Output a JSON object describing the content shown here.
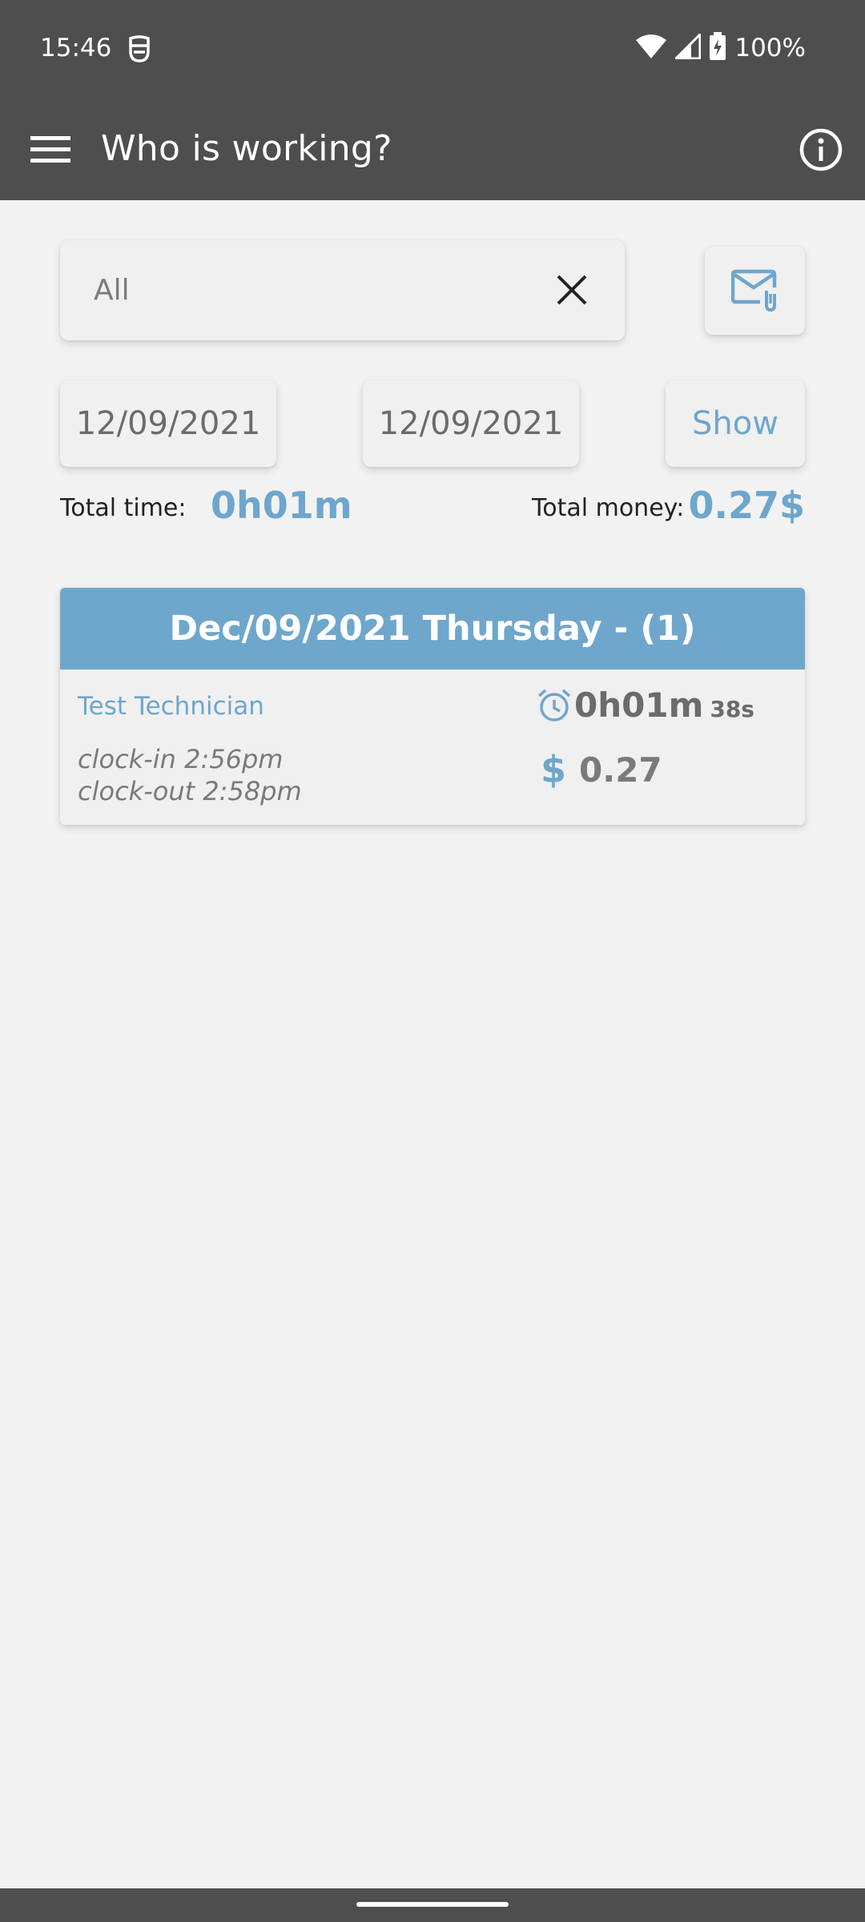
{
  "status_bar": {
    "time": "15:46",
    "battery": "100%",
    "icons": [
      "notification-icon",
      "wifi-icon",
      "signal-icon",
      "battery-charging-icon"
    ]
  },
  "app_bar": {
    "title": "Who is working?",
    "menu_icon": "hamburger-menu-icon",
    "info_icon": "info-icon"
  },
  "filter": {
    "value": "All",
    "clear_icon": "close-icon",
    "mail_icon": "mail-attachment-icon"
  },
  "dates": {
    "from": "12/09/2021",
    "to": "12/09/2021",
    "show_label": "Show"
  },
  "totals": {
    "time_label": "Total time:",
    "time_value": "0h01m",
    "money_label": "Total money:",
    "money_value": "0.27$"
  },
  "days": [
    {
      "header": "Dec/09/2021 Thursday - (1)",
      "entries": [
        {
          "name": "Test Technician",
          "clock_in": "clock-in 2:56pm",
          "clock_out": "clock-out 2:58pm",
          "duration": "0h01m",
          "duration_seconds": "38s",
          "money_symbol": "$",
          "money": "0.27"
        }
      ]
    }
  ],
  "colors": {
    "bar": "#4e4e4e",
    "accent": "#6fa6cc",
    "background": "#f2f2f2",
    "card": "#f0f0f0"
  }
}
